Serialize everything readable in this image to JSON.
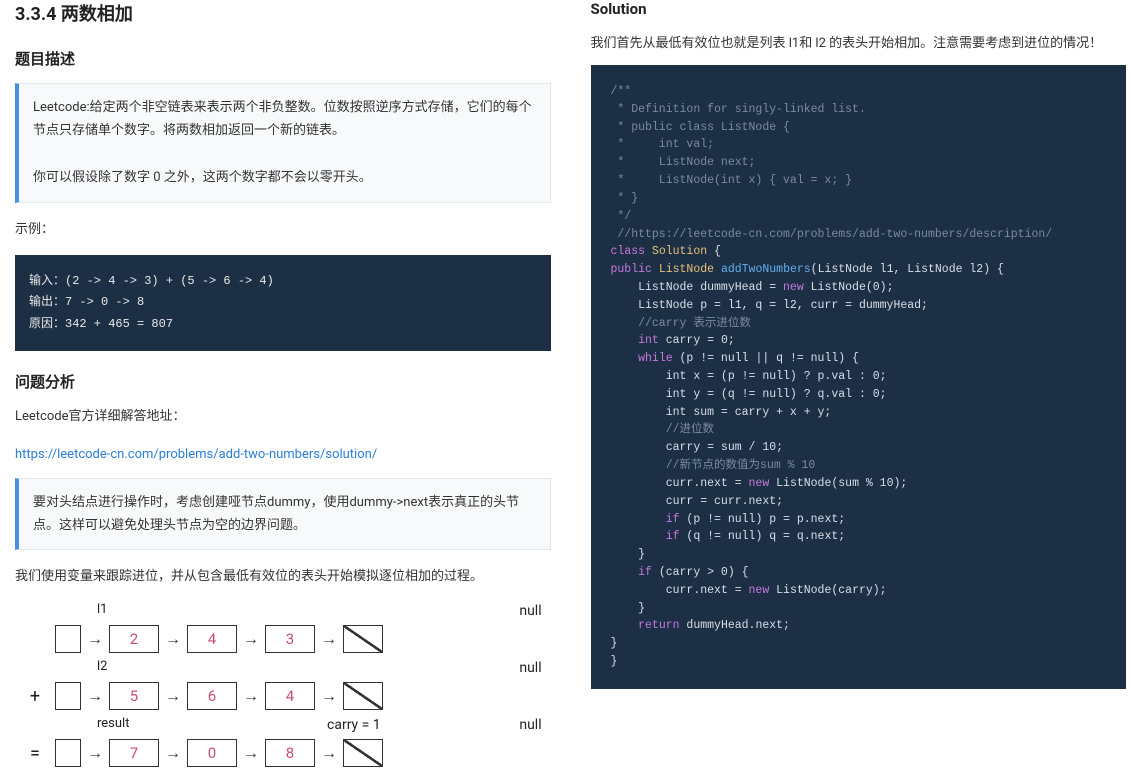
{
  "left": {
    "section_title": "3.3.4 两数相加",
    "desc_heading": "题目描述",
    "desc_p1": "Leetcode:给定两个非空链表来表示两个非负整数。位数按照逆序方式存储，它们的每个节点只存储单个数字。将两数相加返回一个新的链表。",
    "desc_p2": "你可以假设除了数字 0 之外，这两个数字都不会以零开头。",
    "example_label": "示例：",
    "example_code": "输入：(2 -> 4 -> 3) + (5 -> 6 -> 4)\n输出：7 -> 0 -> 8\n原因：342 + 465 = 807",
    "analysis_heading": "问题分析",
    "official_label": "Leetcode官方详细解答地址：",
    "official_url": "https://leetcode-cn.com/problems/add-two-numbers/solution/",
    "tip_text": "要对头结点进行操作时，考虑创建哑节点dummy，使用dummy->next表示真正的头节点。这样可以避免处理头节点为空的边界问题。",
    "track_text": "我们使用变量来跟踪进位，并从包含最低有效位的表头开始模拟逐位相加的过程。",
    "diagram": {
      "l1_label": "l1",
      "l2_label": "l2",
      "result_label": "result",
      "carry_label": "carry = 1",
      "null_label": "null",
      "l1": [
        "2",
        "4",
        "3"
      ],
      "l2": [
        "5",
        "6",
        "4"
      ],
      "result": [
        "7",
        "0",
        "8"
      ],
      "plus": "+",
      "eq": "="
    }
  },
  "right": {
    "solution_heading": "Solution",
    "solution_intro": "我们首先从最低有效位也就是列表 l1和 l2 的表头开始相加。注意需要考虑到进位的情况！",
    "code": {
      "c0": "/**",
      "c1": " * Definition for singly-linked list.",
      "c2": " * public class ListNode {",
      "c3": " *     int val;",
      "c4": " *     ListNode next;",
      "c5": " *     ListNode(int x) { val = x; }",
      "c6": " * }",
      "c7": " */",
      "c8": " //https://leetcode-cn.com/problems/add-two-numbers/description/",
      "line_class": "class",
      "sol": "Solution",
      "public": "public",
      "ln_type": "ListNode",
      "method": "addTwoNumbers",
      "params": "(ListNode l1, ListNode l2) {",
      "dummy": "    ListNode dummyHead = ",
      "new": "new",
      "ln0": " ListNode(0);",
      "pq": "    ListNode p = l1, q = l2, curr = dummyHead;",
      "cm_carry": "    //carry 表示进位数",
      "int": "int",
      "carry0": " carry = 0;",
      "while": "while",
      "while_cond": " (p != null || q != null) {",
      "intx": "        int x = (p != null) ? p.val : 0;",
      "inty": "        int y = (q != null) ? q.val : 0;",
      "intsum": "        int sum = carry + x + y;",
      "cm_jin": "        //进位数",
      "carry_assign": "        carry = sum / 10;",
      "cm_new": "        //新节点的数值为sum % 10",
      "currnext": "        curr.next = ",
      "ln_mod": " ListNode(sum % 10);",
      "curr_curr": "        curr = curr.next;",
      "if": "if",
      "if_p": " (p != null) p = p.next;",
      "if_q": " (q != null) q = q.next;",
      "brace_close": "    }",
      "if_carry": " (carry > 0) {",
      "carry_node": "        curr.next = ",
      "ln_carry": " ListNode(carry);",
      "brace_close2": "    }",
      "return": "return",
      "ret_val": " dummyHead.next;",
      "brace_close3": "}",
      "brace_close4": "}"
    }
  }
}
